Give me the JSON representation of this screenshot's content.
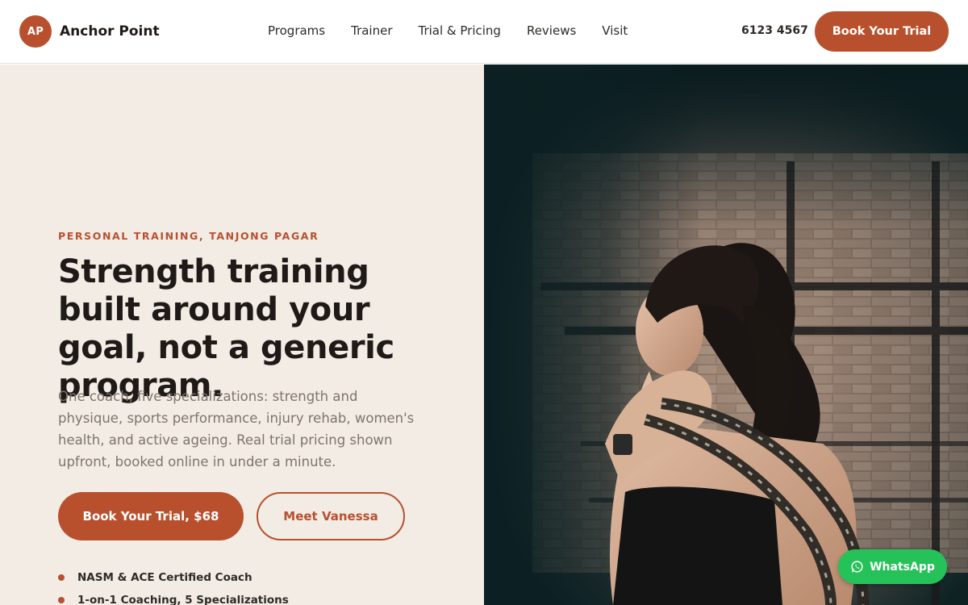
{
  "brand": {
    "initials": "AP",
    "name": "Anchor Point"
  },
  "nav": {
    "items": [
      "Programs",
      "Trainer",
      "Trial & Pricing",
      "Reviews",
      "Visit"
    ]
  },
  "header": {
    "phone": "6123 4567",
    "cta_label": "Book Your Trial"
  },
  "hero": {
    "eyebrow": "PERSONAL TRAINING, TANJONG PAGAR",
    "headline": "Strength training built around your goal, not a generic program.",
    "lede": "One coach, five specializations: strength and physique, sports performance, injury rehab, women's health, and active ageing. Real trial pricing shown upfront, booked online in under a minute.",
    "primary_cta": "Book Your Trial, $68",
    "secondary_cta": "Meet Vanessa",
    "trust_points": [
      "NASM & ACE Certified Coach",
      "1-on-1 Coaching, 5 Specializations"
    ]
  },
  "whatsapp": {
    "label": "WhatsApp",
    "icon": "whatsapp-icon"
  },
  "colors": {
    "accent": "#b8502e",
    "hero_bg": "#f2ece5",
    "whatsapp": "#25c25a"
  }
}
